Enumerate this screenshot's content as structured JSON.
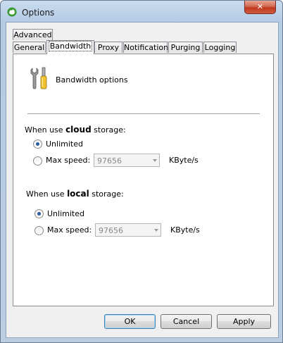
{
  "window": {
    "title": "Options"
  },
  "tabs": {
    "row1": [
      {
        "label": "Advanced"
      }
    ],
    "row2": [
      {
        "label": "General"
      },
      {
        "label": "Bandwidth",
        "active": true
      },
      {
        "label": "Proxy"
      },
      {
        "label": "Notification"
      },
      {
        "label": "Purging"
      },
      {
        "label": "Logging"
      }
    ]
  },
  "header": {
    "title": "Bandwidth options",
    "icon": "tools-icon"
  },
  "cloud": {
    "label_prefix": "When use ",
    "label_bold": "cloud",
    "label_suffix": " storage:",
    "unlimited_label": "Unlimited",
    "maxspeed_label": "Max speed:",
    "maxspeed_value": "97656",
    "unit": "KByte/s",
    "selected": "unlimited"
  },
  "local": {
    "label_prefix": "When use ",
    "label_bold": "local",
    "label_suffix": " storage:",
    "unlimited_label": "Unlimited",
    "maxspeed_label": "Max speed:",
    "maxspeed_value": "97656",
    "unit": "KByte/s",
    "selected": "unlimited"
  },
  "buttons": {
    "ok": "OK",
    "cancel": "Cancel",
    "apply": "Apply"
  },
  "colors": {
    "title_bg": "#b9cde3",
    "close": "#c0381f",
    "radio_dot": "#2a5d9f"
  }
}
